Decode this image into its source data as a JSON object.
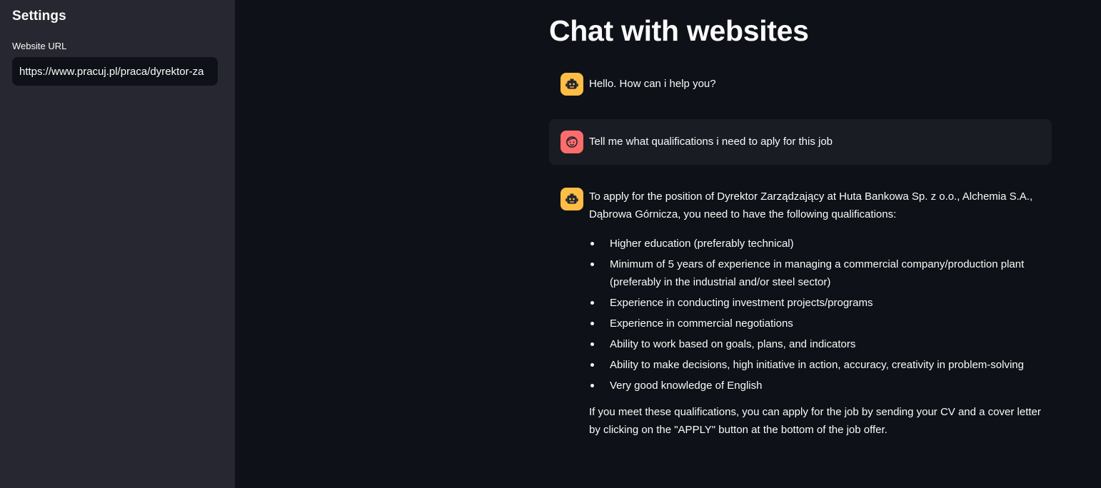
{
  "sidebar": {
    "title": "Settings",
    "url_label": "Website URL",
    "url_value": "https://www.pracuj.pl/praca/dyrektor-za"
  },
  "main": {
    "title": "Chat with websites",
    "messages": [
      {
        "role": "assistant",
        "avatar_icon": "robot-icon",
        "text": "Hello. How can i help you?"
      },
      {
        "role": "user",
        "avatar_icon": "smiling-face-icon",
        "text": "Tell me what qualifications i need to aply for this job"
      },
      {
        "role": "assistant",
        "avatar_icon": "robot-icon",
        "intro": "To apply for the position of Dyrektor Zarządzający at Huta Bankowa Sp. z o.o., Alchemia S.A., Dąbrowa Górnicza, you need to have the following qualifications:",
        "bullets": [
          "Higher education (preferably technical)",
          "Minimum of 5 years of experience in managing a commercial company/production plant (preferably in the industrial and/or steel sector)",
          "Experience in conducting investment projects/programs",
          "Experience in commercial negotiations",
          "Ability to work based on goals, plans, and indicators",
          "Ability to make decisions, high initiative in action, accuracy, creativity in problem-solving",
          "Very good knowledge of English"
        ],
        "closing": "If you meet these qualifications, you can apply for the job by sending your CV and a cover letter by clicking on the \"APPLY\" button at the bottom of the job offer."
      }
    ]
  },
  "colors": {
    "background": "#0e1117",
    "sidebar": "#262730",
    "user_message_bg": "#1a1c24",
    "assistant_avatar": "#ffbd45",
    "user_avatar": "#ff6c6c",
    "text": "#fafafa"
  }
}
